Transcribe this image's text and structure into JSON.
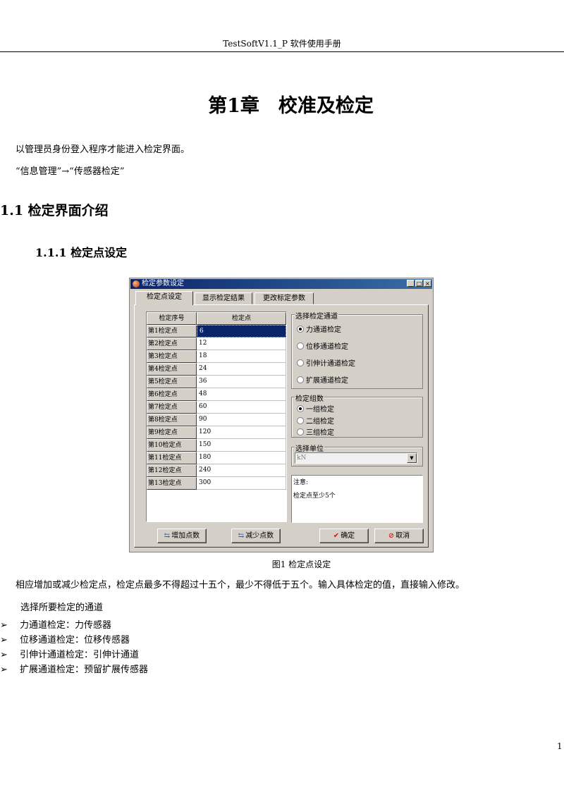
{
  "header": {
    "running_title": "TestSoftV1.1_P 软件使用手册"
  },
  "chapter_title": "第1章　校准及检定",
  "intro": [
    "以管理员身份登入程序才能进入检定界面。",
    "“信息管理”→“传感器检定”"
  ],
  "section_1_1": "1.1 检定界面介绍",
  "section_1_1_1": "1.1.1  检定点设定",
  "dialog": {
    "title": "检定参数设定",
    "window_controls": {
      "minimize": "_",
      "maximize": "□",
      "close": "×"
    },
    "tabs": [
      "检定点设定",
      "显示检定结果",
      "更改标定参数"
    ],
    "grid": {
      "headers": [
        "检定序号",
        "检定点"
      ],
      "rows": [
        [
          "第1检定点",
          "6"
        ],
        [
          "第2检定点",
          "12"
        ],
        [
          "第3检定点",
          "18"
        ],
        [
          "第4检定点",
          "24"
        ],
        [
          "第5检定点",
          "36"
        ],
        [
          "第6检定点",
          "48"
        ],
        [
          "第7检定点",
          "60"
        ],
        [
          "第8检定点",
          "90"
        ],
        [
          "第9检定点",
          "120"
        ],
        [
          "第10检定点",
          "150"
        ],
        [
          "第11检定点",
          "180"
        ],
        [
          "第12检定点",
          "240"
        ],
        [
          "第13检定点",
          "300"
        ]
      ]
    },
    "channel_group": {
      "title": "选择检定通道",
      "options": [
        "力通道检定",
        "位移通道检定",
        "引伸计通道检定",
        "扩展通道检定"
      ]
    },
    "group_count": {
      "title": "检定组数",
      "options": [
        "一组检定",
        "二组检定",
        "三组检定"
      ]
    },
    "unit": {
      "title": "选择单位",
      "value": "kN"
    },
    "note": {
      "label": "注意:",
      "text": "检定点至少5个"
    },
    "buttons": {
      "add": "增加点数",
      "remove": "减少点数",
      "ok": "确定",
      "cancel": "取消"
    },
    "icons": {
      "add": "⇆",
      "remove": "⇆",
      "ok": "✔",
      "cancel": "⊘"
    }
  },
  "figure_caption": "图1  检定点设定",
  "para_after": "相应增加或减少检定点，检定点最多不得超过十五个，最少不得低于五个。输入具体检定的值，直接输入修改。",
  "para_select": "选择所要检定的通道",
  "bullet_marker": "➢",
  "bullets": [
    "力通道检定：力传感器",
    "位移通道检定：位移传感器",
    "引伸计通道检定：引伸计通道",
    "扩展通道检定：预留扩展传感器"
  ],
  "page_number": "1"
}
